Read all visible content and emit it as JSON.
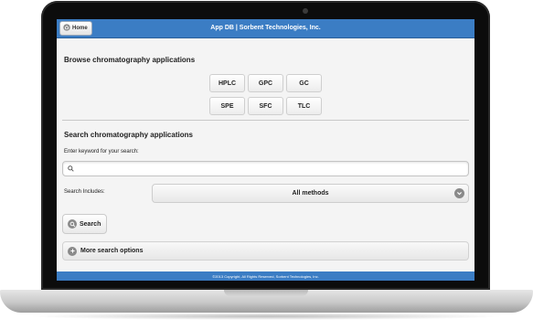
{
  "header": {
    "home_label": "Home",
    "title": "App DB | Sorbent Technologies, Inc.",
    "accent_color": "#3b7dc4"
  },
  "browse": {
    "title": "Browse chromatography applications",
    "techniques": [
      "HPLC",
      "GPC",
      "GC",
      "SPE",
      "SFC",
      "TLC"
    ]
  },
  "search": {
    "title": "Search chromatography applications",
    "keyword_label": "Enter keyword for your search:",
    "keyword_value": "",
    "includes_label": "Search Includes:",
    "includes_selected": "All methods",
    "search_button": "Search",
    "more_options": "More search options"
  },
  "footer": {
    "text": "©2013 Copyright, All Rights Reserved, Sorbent Technologies, Inc."
  },
  "icons": {
    "home": "home-icon",
    "search": "search-icon",
    "select": "chevron-down-icon",
    "more": "plus-circle-icon"
  }
}
